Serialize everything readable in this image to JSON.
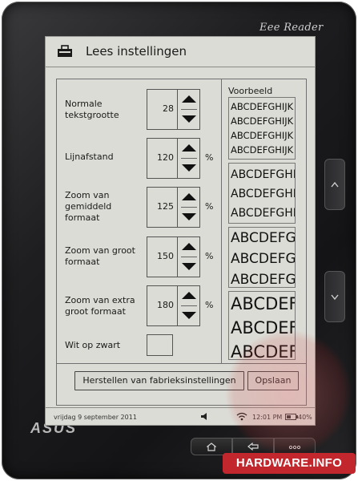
{
  "device": {
    "brand": "Eee Reader",
    "manufacturer": "ASUS"
  },
  "window": {
    "title": "Lees instellingen"
  },
  "settings": {
    "rows": [
      {
        "label": "Normale tekstgrootte",
        "value": "28",
        "unit": ""
      },
      {
        "label": "Lijnafstand",
        "value": "120",
        "unit": "%"
      },
      {
        "label": "Zoom van gemiddeld formaat",
        "value": "125",
        "unit": "%"
      },
      {
        "label": "Zoom van groot formaat",
        "value": "150",
        "unit": "%"
      },
      {
        "label": "Zoom van extra groot formaat",
        "value": "180",
        "unit": "%"
      }
    ],
    "checkbox_label": "Wit op zwart"
  },
  "preview": {
    "title": "Voorbeeld",
    "sample_text": "ABCDEFGHIJK"
  },
  "buttons": {
    "reset": "Herstellen van fabrieksinstellingen",
    "save": "Opslaan"
  },
  "status": {
    "date": "vrijdag 9 september 2011",
    "time": "12:01 PM",
    "battery": "40%"
  },
  "watermark": {
    "text": "HARDWARE.INFO"
  },
  "colors": {
    "screen": "#dcdcd6",
    "bezel": "#1e1e20",
    "watermark": "#c1272d"
  },
  "icons": {
    "title": "toolbox-icon",
    "home": "home-icon",
    "back": "back-arrow-icon",
    "menu": "more-dots-icon"
  }
}
